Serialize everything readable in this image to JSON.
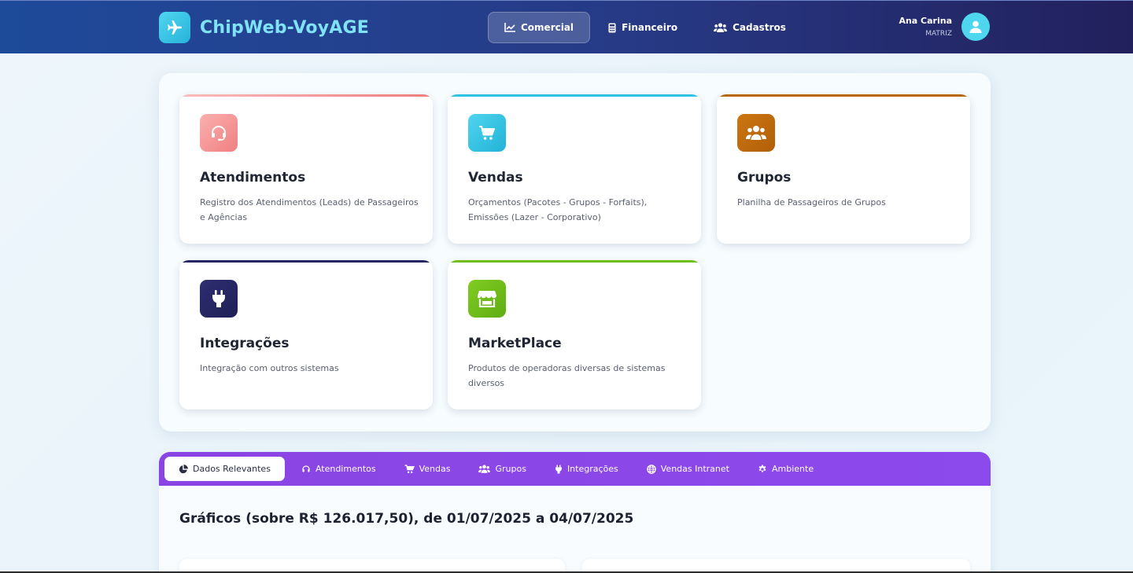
{
  "header": {
    "brand": "ChipWeb-VoyAGE",
    "nav": [
      {
        "label": "Comercial",
        "icon": "chart-line-icon",
        "active": true
      },
      {
        "label": "Financeiro",
        "icon": "calculator-icon",
        "active": false
      },
      {
        "label": "Cadastros",
        "icon": "users-icon",
        "active": false
      }
    ],
    "user": {
      "name": "Ana Carina",
      "role": "MATRIZ"
    }
  },
  "modules": [
    {
      "title": "Atendimentos",
      "description": "Registro dos Atendimentos (Leads) de Passageiros e Agências",
      "icon": "headset-icon",
      "color": "#f78a8a"
    },
    {
      "title": "Vendas",
      "description": "Orçamentos (Pacotes - Grupos - Forfaits), Emissões (Lazer - Corporativo)",
      "icon": "cart-icon",
      "color": "#2fc3e3"
    },
    {
      "title": "Grupos",
      "description": "Planilha de Passageiros de Grupos",
      "icon": "users-icon",
      "color": "#bf6a0a"
    },
    {
      "title": "Integrações",
      "description": "Integração com outros sistemas",
      "icon": "plug-icon",
      "color": "#262663"
    },
    {
      "title": "MarketPlace",
      "description": "Produtos de operadoras diversas de sistemas diversos",
      "icon": "store-icon",
      "color": "#6fbe1a"
    }
  ],
  "tabs": [
    {
      "label": "Dados Relevantes",
      "icon": "pie-chart-icon",
      "active": true
    },
    {
      "label": "Atendimentos",
      "icon": "headset-icon",
      "active": false
    },
    {
      "label": "Vendas",
      "icon": "cart-icon",
      "active": false
    },
    {
      "label": "Grupos",
      "icon": "users-icon",
      "active": false
    },
    {
      "label": "Integrações",
      "icon": "plug-icon",
      "active": false
    },
    {
      "label": "Vendas Intranet",
      "icon": "globe-icon",
      "active": false
    },
    {
      "label": "Ambiente",
      "icon": "gear-icon",
      "active": false
    }
  ],
  "dashboard": {
    "title": "Gráficos (sobre R$ 126.017,50), de 01/07/2025 a 04/07/2025"
  }
}
